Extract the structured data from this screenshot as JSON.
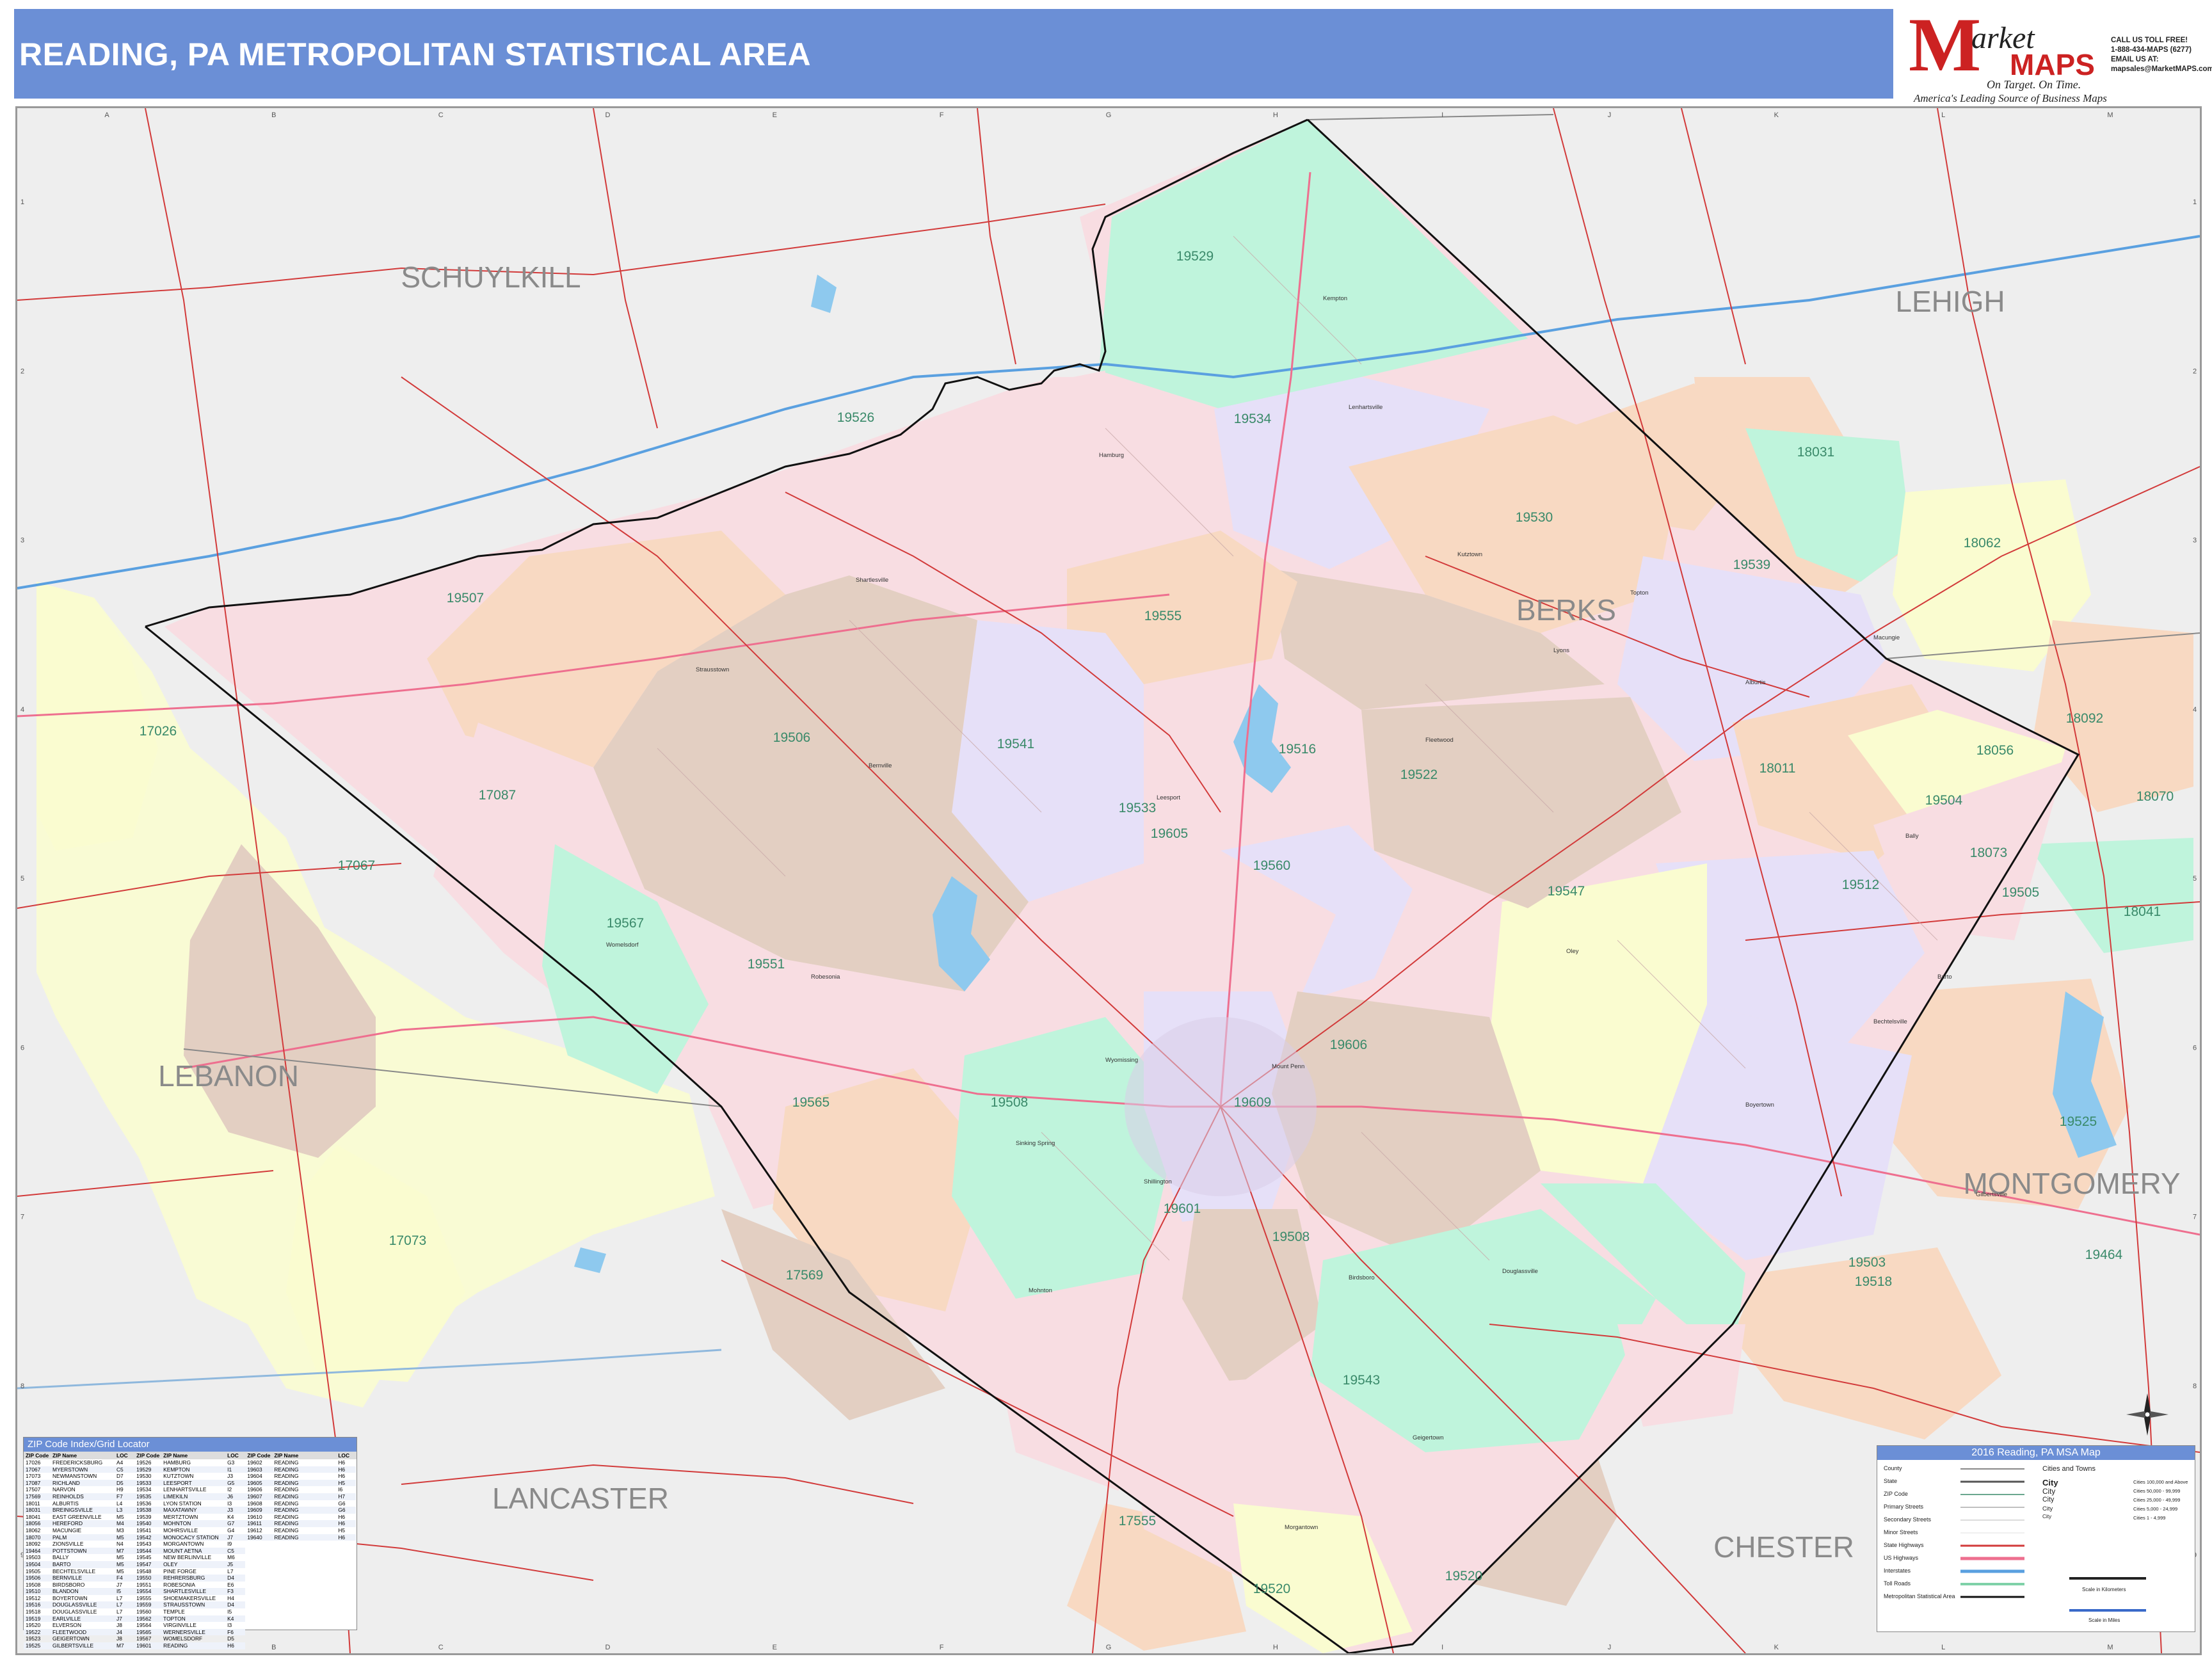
{
  "header": {
    "title": "READING, PA METROPOLITAN STATISTICAL AREA"
  },
  "logo": {
    "brand_m": "M",
    "brand_rest": "arket",
    "brand_maps": "MAPS",
    "tagline": "On Target.  On Time.",
    "subtagline": "America's Leading Source of  Business Maps"
  },
  "contact": {
    "line1": "CALL US TOLL FREE!",
    "line2": "1-888-434-MAPS  (6277)",
    "line3": "EMAIL US AT:",
    "line4": "mapsales@MarketMAPS.com"
  },
  "grid": {
    "columns": [
      "A",
      "B",
      "C",
      "D",
      "E",
      "F",
      "G",
      "H",
      "I",
      "J",
      "K",
      "L",
      "M"
    ],
    "rows": [
      "1",
      "2",
      "3",
      "4",
      "5",
      "6",
      "7",
      "8",
      "9"
    ]
  },
  "counties": {
    "schuylkill": "SCHUYLKILL",
    "lehigh": "LEHIGH",
    "berks": "BERKS",
    "lebanon": "LEBANON",
    "montgomery": "MONTGOMERY",
    "lancaster": "LANCASTER",
    "chester": "CHESTER"
  },
  "zips": [
    "19529",
    "19526",
    "19534",
    "18031",
    "19530",
    "18062",
    "19507",
    "19539",
    "19555",
    "17026",
    "19541",
    "19506",
    "19516",
    "19522",
    "18011",
    "18056",
    "19504",
    "18092",
    "18070",
    "17087",
    "19533",
    "19605",
    "17067",
    "19560",
    "19547",
    "19512",
    "18073",
    "19505",
    "18041",
    "19567",
    "19551",
    "19606",
    "19508",
    "19525",
    "19565",
    "19609",
    "19601",
    "19503",
    "19464",
    "17569",
    "17073",
    "19543",
    "19508",
    "19518",
    "17555",
    "19520",
    "19520"
  ],
  "towns": {
    "hamburg": "Hamburg",
    "kutztown": "Kutztown",
    "fleetwood": "Fleetwood",
    "shartlesville": "Shartlesville",
    "bernville": "Bernville",
    "womelsdorf": "Womelsdorf",
    "boyertown": "Boyertown",
    "birdsboro": "Birdsboro",
    "morgantown": "Morgantown",
    "shillington": "Shillington",
    "wyomissing": "Wyomissing",
    "sinking_spring": "Sinking Spring",
    "topton": "Topton",
    "lyons": "Lyons",
    "bally": "Bally",
    "bechtelsville": "Bechtelsville",
    "alburtis": "Alburtis",
    "macungie": "Macungie",
    "robesonia": "Robesonia",
    "leesport": "Leesport",
    "mohnton": "Mohnton",
    "kempton": "Kempton",
    "lenhartsville": "Lenhartsville",
    "strausstown": "Strausstown",
    "mount_penn": "Mount Penn",
    "douglassville": "Douglassville",
    "oley": "Oley",
    "barto": "Barto",
    "gilbertsville": "Gilbertsville",
    "geigertown": "Geigertown"
  },
  "zip_index": {
    "title": "ZIP Code Index/Grid Locator",
    "headers": [
      "ZIP Code",
      "ZIP Name",
      "LOC"
    ],
    "rows": [
      [
        "17026",
        "FREDERICKSBURG",
        "A4"
      ],
      [
        "17067",
        "MYERSTOWN",
        "C5"
      ],
      [
        "17073",
        "NEWMANSTOWN",
        "D7"
      ],
      [
        "17087",
        "RICHLAND",
        "D5"
      ],
      [
        "17507",
        "NARVON",
        "H9"
      ],
      [
        "17569",
        "REINHOLDS",
        "F7"
      ],
      [
        "18011",
        "ALBURTIS",
        "L4"
      ],
      [
        "18031",
        "BREINIGSVILLE",
        "L3"
      ],
      [
        "18041",
        "EAST GREENVILLE",
        "M5"
      ],
      [
        "18056",
        "HEREFORD",
        "M4"
      ],
      [
        "18062",
        "MACUNGIE",
        "M3"
      ],
      [
        "18070",
        "PALM",
        "M5"
      ],
      [
        "18092",
        "ZIONSVILLE",
        "N4"
      ],
      [
        "19464",
        "POTTSTOWN",
        "M7"
      ],
      [
        "19503",
        "BALLY",
        "M5"
      ],
      [
        "19504",
        "BARTO",
        "M5"
      ],
      [
        "19505",
        "BECHTELSVILLE",
        "M5"
      ],
      [
        "19506",
        "BERNVILLE",
        "F4"
      ],
      [
        "19508",
        "BIRDSBORO",
        "J7"
      ],
      [
        "19510",
        "BLANDON",
        "I5"
      ],
      [
        "19512",
        "BOYERTOWN",
        "L7"
      ],
      [
        "19516",
        "DOUGLASSVILLE",
        "L7"
      ],
      [
        "19518",
        "DOUGLASSVILLE",
        "L7"
      ],
      [
        "19519",
        "EARLVILLE",
        "J7"
      ],
      [
        "19520",
        "ELVERSON",
        "J8"
      ],
      [
        "19522",
        "FLEETWOOD",
        "J4"
      ],
      [
        "19523",
        "GEIGERTOWN",
        "J8"
      ],
      [
        "19525",
        "GILBERTSVILLE",
        "M7"
      ],
      [
        "19526",
        "HAMBURG",
        "G3"
      ],
      [
        "19529",
        "KEMPTON",
        "I1"
      ],
      [
        "19530",
        "KUTZTOWN",
        "J3"
      ],
      [
        "19533",
        "LEESPORT",
        "G5"
      ],
      [
        "19534",
        "LENHARTSVILLE",
        "I2"
      ],
      [
        "19535",
        "LIMEKILN",
        "J6"
      ],
      [
        "19536",
        "LYON STATION",
        "I3"
      ],
      [
        "19538",
        "MAXATAWNY",
        "J3"
      ],
      [
        "19539",
        "MERTZTOWN",
        "K4"
      ],
      [
        "19540",
        "MOHNTON",
        "G7"
      ],
      [
        "19541",
        "MOHRSVILLE",
        "G4"
      ],
      [
        "19542",
        "MONOCACY STATION",
        "J7"
      ],
      [
        "19543",
        "MORGANTOWN",
        "I9"
      ],
      [
        "19544",
        "MOUNT AETNA",
        "C5"
      ],
      [
        "19545",
        "NEW BERLINVILLE",
        "M6"
      ],
      [
        "19547",
        "OLEY",
        "J5"
      ],
      [
        "19548",
        "PINE FORGE",
        "L7"
      ],
      [
        "19550",
        "REHRERSBURG",
        "D4"
      ],
      [
        "19551",
        "ROBESONIA",
        "E6"
      ],
      [
        "19554",
        "SHARTLESVILLE",
        "F3"
      ],
      [
        "19555",
        "SHOEMAKERSVILLE",
        "H4"
      ],
      [
        "19559",
        "STRAUSSTOWN",
        "D4"
      ],
      [
        "19560",
        "TEMPLE",
        "I5"
      ],
      [
        "19562",
        "TOPTON",
        "K4"
      ],
      [
        "19564",
        "VIRGINVILLE",
        "I3"
      ],
      [
        "19565",
        "WERNERSVILLE",
        "F6"
      ],
      [
        "19567",
        "WOMELSDORF",
        "D5"
      ],
      [
        "19601",
        "READING",
        "H6"
      ],
      [
        "19602",
        "READING",
        "H6"
      ],
      [
        "19603",
        "READING",
        "H6"
      ],
      [
        "19604",
        "READING",
        "H6"
      ],
      [
        "19605",
        "READING",
        "H5"
      ],
      [
        "19606",
        "READING",
        "I6"
      ],
      [
        "19607",
        "READING",
        "H7"
      ],
      [
        "19608",
        "READING",
        "G6"
      ],
      [
        "19609",
        "READING",
        "G6"
      ],
      [
        "19610",
        "READING",
        "H6"
      ],
      [
        "19611",
        "READING",
        "H6"
      ],
      [
        "19612",
        "READING",
        "H5"
      ],
      [
        "19640",
        "READING",
        "H6"
      ]
    ]
  },
  "legend": {
    "title": "2016 Reading, PA MSA Map",
    "items": [
      "County",
      "State",
      "ZIP Code",
      "Primary Streets",
      "Secondary Streets",
      "Minor Streets",
      "State Highways",
      "US Highways",
      "Interstates",
      "Toll Roads",
      "Metropolitan Statistical Area"
    ],
    "cities_header": "Cities and Towns",
    "city_sizes": [
      {
        "label": "City",
        "desc": "Cities 100,000 and Above"
      },
      {
        "label": "City",
        "desc": "Cities 50,000 - 99,999"
      },
      {
        "label": "City",
        "desc": "Cities 25,000 - 49,999"
      },
      {
        "label": "City",
        "desc": "Cities 5,000 - 24,999"
      },
      {
        "label": "City",
        "desc": "Cities 1 - 4,999"
      }
    ],
    "scale_km": "Scale in Kilometers",
    "scale_mi": "Scale in Miles"
  },
  "colors": {
    "header_bg": "#6b8fd6",
    "outside": "#eeeeee",
    "pink": "#f8dde2",
    "green": "#bff4dc",
    "lavender": "#e6e0f8",
    "peach": "#f8d9c2",
    "tan": "#e3cfc2",
    "yellow": "#fafcd0",
    "road_primary": "#d23a3a",
    "road_us": "#ee6f8f",
    "interstate": "#5aa0e0",
    "water": "#8ec9ee",
    "msa_border": "#111111"
  }
}
